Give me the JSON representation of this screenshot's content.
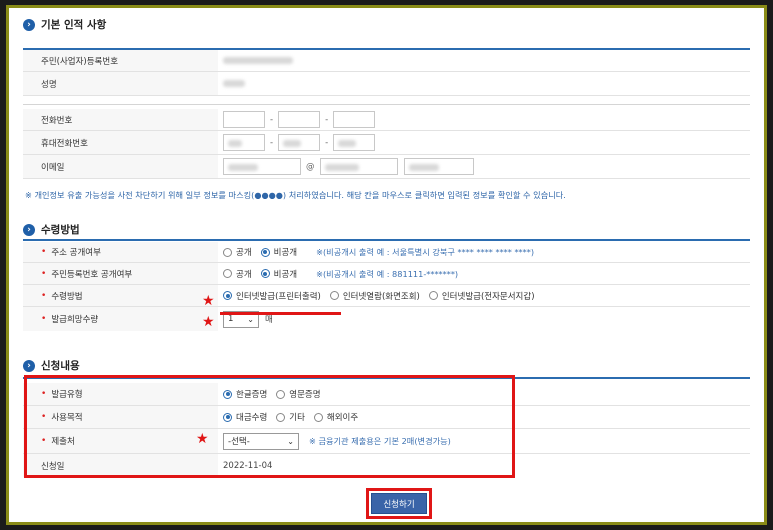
{
  "section1": {
    "title": "기본 인적 사항",
    "rows": [
      {
        "label": "주민(사업자)등록번호"
      },
      {
        "label": "성명"
      },
      {
        "label": "전화번호"
      },
      {
        "label": "휴대전화번호",
        "dash1": "-",
        "dash2": "-"
      },
      {
        "label": "이메일"
      }
    ],
    "phone_dash": "-",
    "email_at": "@",
    "masking_notice": "※ 개인정보 유출 가능성을 사전 차단하기 위해 일부 정보를 마스킹(●●●●) 처리하였습니다. 해당 칸을 마우스로 클릭하면 입력된 정보를 확인할 수 있습니다."
  },
  "section2": {
    "title": "수령방법",
    "address": {
      "label": "주소 공개여부",
      "opt_public": "공개",
      "opt_private": "비공개",
      "note": "※(비공개시 출력 예 : 서울특별시 강북구 **** **** **** ****)"
    },
    "resident": {
      "label": "주민등록번호 공개여부",
      "opt_public": "공개",
      "opt_private": "비공개",
      "note": "※(비공개시 출력 예 : 881111-*******)"
    },
    "method": {
      "label": "수령방법",
      "opt1": "인터넷발급(프린터출력)",
      "opt2": "인터넷열람(화면조회)",
      "opt3": "인터넷발급(전자문서지갑)"
    },
    "quantity": {
      "label": "발급희망수량",
      "value": "1",
      "unit": "매"
    }
  },
  "section3": {
    "title": "신청내용",
    "issue_type": {
      "label": "발급유형",
      "opt1": "한글증명",
      "opt2": "영문증명"
    },
    "purpose": {
      "label": "사용목적",
      "opt1": "대금수령",
      "opt2": "기타",
      "opt3": "해외이주"
    },
    "submit_to": {
      "label": "제출처",
      "value": "-선택-",
      "note": "※ 금융기관 제출용은 기본 2매(변경가능)"
    },
    "apply_date": {
      "label": "신청일",
      "value": "2022-11-04"
    }
  },
  "submit_label": "신청하기",
  "required_mark": "•",
  "star": "★",
  "colors": {
    "accent": "#2b6cb0",
    "highlight": "#e01616",
    "frame": "#8a8c18",
    "button": "#3a64a8"
  }
}
